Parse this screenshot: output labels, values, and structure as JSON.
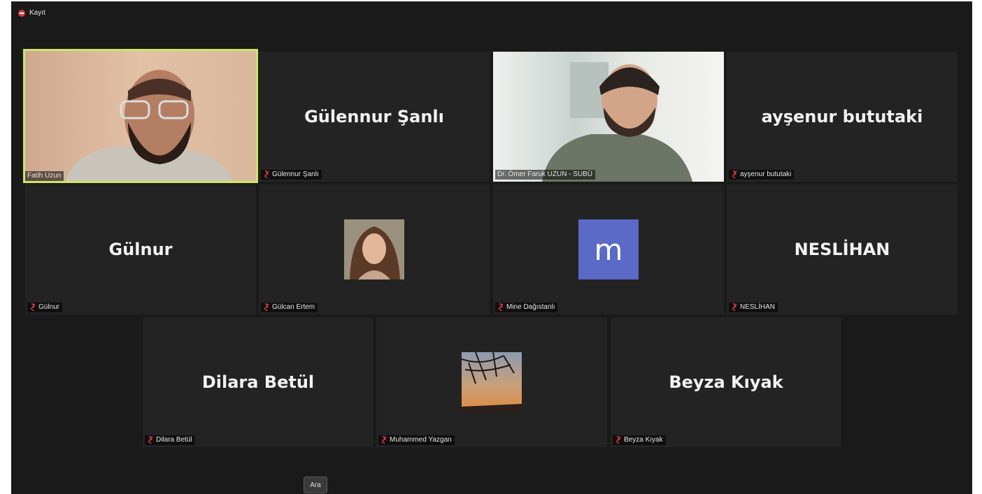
{
  "recording": {
    "label": "Kayıt",
    "color": "#e0393e"
  },
  "tiles": [
    {
      "display_name": "",
      "label": "Fatih Uzun",
      "muted": false,
      "active": true,
      "kind": "video-fatih"
    },
    {
      "display_name": "Gülennur Şanlı",
      "label": "Gülennur Şanlı",
      "muted": true,
      "kind": "name"
    },
    {
      "display_name": "",
      "label": "Dr. Ömer Faruk UZUN - SUBÜ",
      "muted": false,
      "kind": "video-omer"
    },
    {
      "display_name": "ayşenur bututaki",
      "label": "ayşenur bututaki",
      "muted": true,
      "kind": "name"
    },
    {
      "display_name": "Gülnur",
      "label": "Gülnur",
      "muted": true,
      "kind": "name"
    },
    {
      "display_name": "",
      "label": "Gülcan Ertem",
      "muted": true,
      "kind": "photo-gulcan"
    },
    {
      "display_name": "",
      "avatar_letter": "m",
      "label": "Mine Dağıstanlı",
      "muted": true,
      "kind": "letter"
    },
    {
      "display_name": "NESLİHAN",
      "label": "NESLİHAN",
      "muted": true,
      "kind": "name"
    },
    {
      "display_name": "Dilara Betül",
      "label": "Dilara Betül",
      "muted": true,
      "kind": "name"
    },
    {
      "display_name": "",
      "label": "Muhammed Yazgan",
      "muted": true,
      "kind": "photo-sunset"
    },
    {
      "display_name": "Beyza Kıyak",
      "label": "Beyza Kıyak",
      "muted": true,
      "kind": "name"
    }
  ],
  "search_button": {
    "label": "Ara"
  },
  "colors": {
    "active_border": "#cde56b",
    "mute_icon": "#e0393e",
    "avatar_bg": "#5b69c7"
  }
}
